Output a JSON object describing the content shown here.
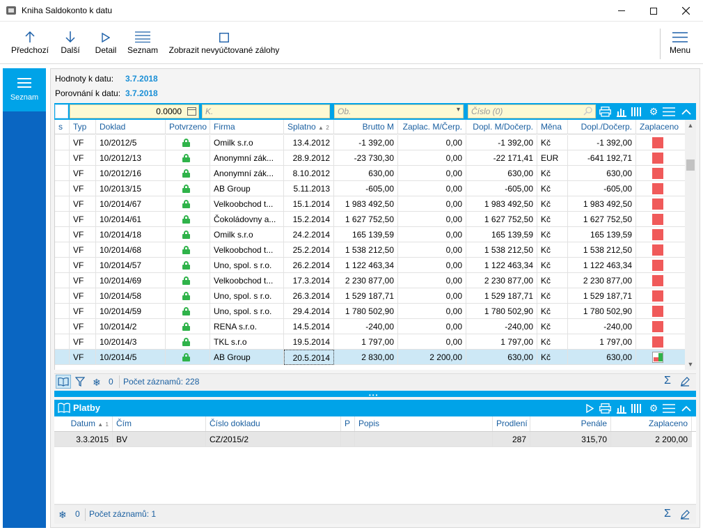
{
  "window": {
    "title": "Kniha Saldokonto k datu"
  },
  "toolbar": {
    "previous": "Předchozí",
    "next": "Další",
    "detail": "Detail",
    "list": "Seznam",
    "show_advances": "Zobrazit nevyúčtované zálohy",
    "menu": "Menu"
  },
  "nav": {
    "seznam": "Seznam"
  },
  "header": {
    "values_date_label": "Hodnoty k datu:",
    "values_date": "3.7.2018",
    "compare_date_label": "Porovnání k datu:",
    "compare_date": "3.7.2018"
  },
  "filters": {
    "amount": "0.0000",
    "k_placeholder": "K.",
    "ob_placeholder": "Ob.",
    "cislo_placeholder": "Číslo (0)"
  },
  "grid": {
    "columns": [
      "s",
      "Typ",
      "Doklad",
      "Potvrzeno",
      "Firma",
      "Splatno",
      "Brutto M",
      "Zaplac. M/Čerp.",
      "Dopl. M/Dočerp.",
      "Měna",
      "Dopl./Dočerp.",
      "Zaplaceno"
    ],
    "sort_indicator": "2",
    "rows": [
      {
        "typ": "VF",
        "doklad": "10/2012/5",
        "firma": "Omilk s.r.o",
        "splatno": "13.4.2012",
        "brutto": "-1 392,00",
        "zaplac": "0,00",
        "dopl_m": "-1 392,00",
        "mena": "Kč",
        "dopl": "-1 392,00",
        "paid": "unpaid"
      },
      {
        "typ": "VF",
        "doklad": "10/2012/13",
        "firma": "Anonymní zák...",
        "splatno": "28.9.2012",
        "brutto": "-23 730,30",
        "zaplac": "0,00",
        "dopl_m": "-22 171,41",
        "mena": "EUR",
        "dopl": "-641 192,71",
        "paid": "unpaid"
      },
      {
        "typ": "VF",
        "doklad": "10/2012/16",
        "firma": "Anonymní zák...",
        "splatno": "8.10.2012",
        "brutto": "630,00",
        "zaplac": "0,00",
        "dopl_m": "630,00",
        "mena": "Kč",
        "dopl": "630,00",
        "paid": "unpaid"
      },
      {
        "typ": "VF",
        "doklad": "10/2013/15",
        "firma": "AB Group",
        "splatno": "5.11.2013",
        "brutto": "-605,00",
        "zaplac": "0,00",
        "dopl_m": "-605,00",
        "mena": "Kč",
        "dopl": "-605,00",
        "paid": "unpaid"
      },
      {
        "typ": "VF",
        "doklad": "10/2014/67",
        "firma": "Velkoobchod t...",
        "splatno": "15.1.2014",
        "brutto": "1 983 492,50",
        "zaplac": "0,00",
        "dopl_m": "1 983 492,50",
        "mena": "Kč",
        "dopl": "1 983 492,50",
        "paid": "unpaid"
      },
      {
        "typ": "VF",
        "doklad": "10/2014/61",
        "firma": "Čokoládovny a...",
        "splatno": "15.2.2014",
        "brutto": "1 627 752,50",
        "zaplac": "0,00",
        "dopl_m": "1 627 752,50",
        "mena": "Kč",
        "dopl": "1 627 752,50",
        "paid": "unpaid"
      },
      {
        "typ": "VF",
        "doklad": "10/2014/18",
        "firma": "Omilk s.r.o",
        "splatno": "24.2.2014",
        "brutto": "165 139,59",
        "zaplac": "0,00",
        "dopl_m": "165 139,59",
        "mena": "Kč",
        "dopl": "165 139,59",
        "paid": "unpaid"
      },
      {
        "typ": "VF",
        "doklad": "10/2014/68",
        "firma": "Velkoobchod t...",
        "splatno": "25.2.2014",
        "brutto": "1 538 212,50",
        "zaplac": "0,00",
        "dopl_m": "1 538 212,50",
        "mena": "Kč",
        "dopl": "1 538 212,50",
        "paid": "unpaid"
      },
      {
        "typ": "VF",
        "doklad": "10/2014/57",
        "firma": "Uno, spol. s r.o.",
        "splatno": "26.2.2014",
        "brutto": "1 122 463,34",
        "zaplac": "0,00",
        "dopl_m": "1 122 463,34",
        "mena": "Kč",
        "dopl": "1 122 463,34",
        "paid": "unpaid"
      },
      {
        "typ": "VF",
        "doklad": "10/2014/69",
        "firma": "Velkoobchod t...",
        "splatno": "17.3.2014",
        "brutto": "2 230 877,00",
        "zaplac": "0,00",
        "dopl_m": "2 230 877,00",
        "mena": "Kč",
        "dopl": "2 230 877,00",
        "paid": "unpaid"
      },
      {
        "typ": "VF",
        "doklad": "10/2014/58",
        "firma": "Uno, spol. s r.o.",
        "splatno": "26.3.2014",
        "brutto": "1 529 187,71",
        "zaplac": "0,00",
        "dopl_m": "1 529 187,71",
        "mena": "Kč",
        "dopl": "1 529 187,71",
        "paid": "unpaid"
      },
      {
        "typ": "VF",
        "doklad": "10/2014/59",
        "firma": "Uno, spol. s r.o.",
        "splatno": "29.4.2014",
        "brutto": "1 780 502,90",
        "zaplac": "0,00",
        "dopl_m": "1 780 502,90",
        "mena": "Kč",
        "dopl": "1 780 502,90",
        "paid": "unpaid"
      },
      {
        "typ": "VF",
        "doklad": "10/2014/2",
        "firma": "RENA s.r.o.",
        "splatno": "14.5.2014",
        "brutto": "-240,00",
        "zaplac": "0,00",
        "dopl_m": "-240,00",
        "mena": "Kč",
        "dopl": "-240,00",
        "paid": "unpaid"
      },
      {
        "typ": "VF",
        "doklad": "10/2014/3",
        "firma": "TKL s.r.o",
        "splatno": "19.5.2014",
        "brutto": "1 797,00",
        "zaplac": "0,00",
        "dopl_m": "1 797,00",
        "mena": "Kč",
        "dopl": "1 797,00",
        "paid": "unpaid"
      },
      {
        "typ": "VF",
        "doklad": "10/2014/5",
        "firma": "AB Group",
        "splatno": "20.5.2014",
        "brutto": "2 830,00",
        "zaplac": "2 200,00",
        "dopl_m": "630,00",
        "mena": "Kč",
        "dopl": "630,00",
        "paid": "partial",
        "selected": true
      }
    ]
  },
  "grid_status": {
    "filter_count": "0",
    "records": "Počet záznamů: 228"
  },
  "payments": {
    "title": "Platby",
    "columns": [
      "Datum",
      "Čím",
      "Číslo dokladu",
      "P",
      "Popis",
      "Prodlení",
      "Penále",
      "Zaplaceno"
    ],
    "sort_indicator": "1",
    "rows": [
      {
        "datum": "3.3.2015",
        "cim": "BV",
        "cislo": "CZ/2015/2",
        "p": "",
        "popis": "",
        "prodleni": "287",
        "penale": "315,70",
        "zaplaceno": "2 200,00"
      }
    ],
    "status": {
      "filter_count": "0",
      "records": "Počet záznamů: 1"
    }
  },
  "colors": {
    "accent": "#00a3e8",
    "nav": "#0a66c2",
    "unpaid": "#f05a5a",
    "paid": "#2fb34a",
    "link": "#1a8fd6"
  }
}
